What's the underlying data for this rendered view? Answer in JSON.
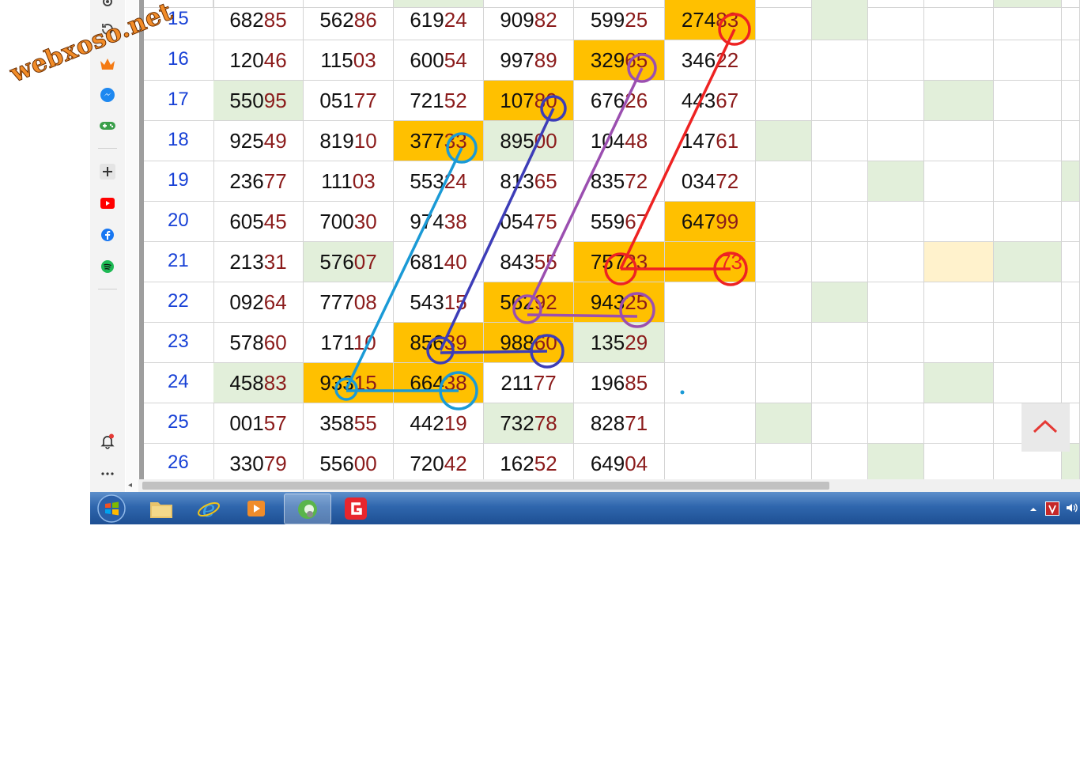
{
  "watermark": "webxoso.net",
  "sidebar": {
    "icons": [
      "gear-icon",
      "history-icon",
      "crown-icon",
      "messenger-icon",
      "gamepad-icon",
      "add-icon",
      "youtube-icon",
      "facebook-icon",
      "spotify-icon",
      "bell-icon",
      "more-icon"
    ]
  },
  "table": {
    "rows": [
      {
        "day": "15",
        "cells": [
          [
            "682",
            "85"
          ],
          [
            "562",
            "86"
          ],
          [
            "619",
            "24"
          ],
          [
            "909",
            "82"
          ],
          [
            "599",
            "25"
          ],
          [
            "274",
            "83"
          ]
        ]
      },
      {
        "day": "16",
        "cells": [
          [
            "120",
            "46"
          ],
          [
            "115",
            "03"
          ],
          [
            "600",
            "54"
          ],
          [
            "997",
            "89"
          ],
          [
            "329",
            "65"
          ],
          [
            "346",
            "22"
          ]
        ]
      },
      {
        "day": "17",
        "cells": [
          [
            "550",
            "95"
          ],
          [
            "051",
            "77"
          ],
          [
            "721",
            "52"
          ],
          [
            "107",
            "80"
          ],
          [
            "676",
            "26"
          ],
          [
            "443",
            "67"
          ]
        ]
      },
      {
        "day": "18",
        "cells": [
          [
            "925",
            "49"
          ],
          [
            "819",
            "10"
          ],
          [
            "377",
            "33"
          ],
          [
            "895",
            "00"
          ],
          [
            "104",
            "48"
          ],
          [
            "147",
            "61"
          ]
        ]
      },
      {
        "day": "19",
        "cells": [
          [
            "236",
            "77"
          ],
          [
            "111",
            "03"
          ],
          [
            "553",
            "24"
          ],
          [
            "813",
            "65"
          ],
          [
            "835",
            "72"
          ],
          [
            "034",
            "72"
          ]
        ]
      },
      {
        "day": "20",
        "cells": [
          [
            "605",
            "45"
          ],
          [
            "700",
            "30"
          ],
          [
            "974",
            "38"
          ],
          [
            "054",
            "75"
          ],
          [
            "559",
            "67"
          ],
          [
            "647",
            "99"
          ]
        ]
      },
      {
        "day": "21",
        "cells": [
          [
            "213",
            "31"
          ],
          [
            "576",
            "07"
          ],
          [
            "681",
            "40"
          ],
          [
            "843",
            "55"
          ],
          [
            "757",
            "23"
          ],
          [
            "",
            "73"
          ]
        ]
      },
      {
        "day": "22",
        "cells": [
          [
            "092",
            "64"
          ],
          [
            "777",
            "08"
          ],
          [
            "543",
            "15"
          ],
          [
            "562",
            "92"
          ],
          [
            "943",
            "25"
          ],
          [
            "",
            ""
          ]
        ]
      },
      {
        "day": "23",
        "cells": [
          [
            "578",
            "60"
          ],
          [
            "171",
            "10"
          ],
          [
            "856",
            "39"
          ],
          [
            "988",
            "60"
          ],
          [
            "135",
            "29"
          ],
          [
            "",
            ""
          ]
        ]
      },
      {
        "day": "24",
        "cells": [
          [
            "458",
            "83"
          ],
          [
            "933",
            "15"
          ],
          [
            "664",
            "38"
          ],
          [
            "211",
            "77"
          ],
          [
            "196",
            "85"
          ],
          [
            "",
            ""
          ]
        ]
      },
      {
        "day": "25",
        "cells": [
          [
            "001",
            "57"
          ],
          [
            "358",
            "55"
          ],
          [
            "442",
            "19"
          ],
          [
            "732",
            "78"
          ],
          [
            "828",
            "71"
          ],
          [
            "",
            ""
          ]
        ]
      },
      {
        "day": "26",
        "cells": [
          [
            "330",
            "79"
          ],
          [
            "556",
            "00"
          ],
          [
            "720",
            "42"
          ],
          [
            "162",
            "52"
          ],
          [
            "649",
            "04"
          ],
          [
            "",
            ""
          ]
        ]
      }
    ]
  },
  "scroll_top_button": "scroll-to-top",
  "taskbar": {
    "buttons": [
      "start-button",
      "file-explorer",
      "internet-explorer",
      "media-player",
      "coccoc-browser",
      "garena-app"
    ],
    "tray": [
      "tray-arrow-icon",
      "tray-v-icon",
      "volume-icon"
    ]
  },
  "colors": {
    "highlight": "#ffc000",
    "light_green": "#e2efda",
    "light_yellow": "#fff2cc",
    "day_blue": "#1740d6",
    "tail_red": "#8b1b1b",
    "line_red": "#ee2222",
    "line_purple": "#9b4fb0",
    "line_indigo": "#3d3db8",
    "line_cyan": "#1a9ad6"
  }
}
